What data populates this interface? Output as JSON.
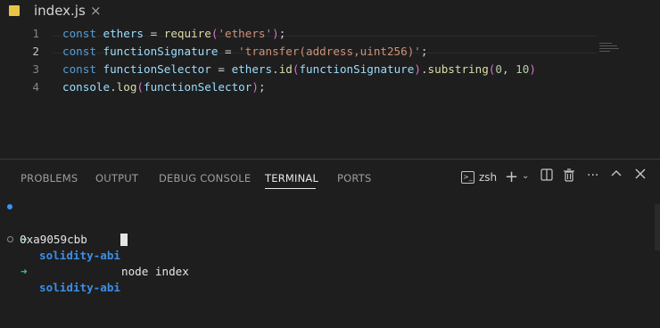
{
  "tab": {
    "name": "index.js",
    "close": "×"
  },
  "editor": {
    "lines": [
      {
        "num": "1",
        "tokens": [
          [
            "kw",
            "const"
          ],
          [
            "pun",
            " "
          ],
          [
            "var",
            "ethers"
          ],
          [
            "pun",
            " = "
          ],
          [
            "fn",
            "require"
          ],
          [
            "br",
            "("
          ],
          [
            "str",
            "'ethers'"
          ],
          [
            "br",
            ")"
          ],
          [
            "pun",
            ";"
          ]
        ]
      },
      {
        "num": "2",
        "tokens": [
          [
            "kw",
            "const"
          ],
          [
            "pun",
            " "
          ],
          [
            "var",
            "functionSignature"
          ],
          [
            "pun",
            " = "
          ],
          [
            "str",
            "'transfer(address,uint256)'"
          ],
          [
            "pun",
            ";"
          ]
        ]
      },
      {
        "num": "3",
        "tokens": [
          [
            "kw",
            "const"
          ],
          [
            "pun",
            " "
          ],
          [
            "var",
            "functionSelector"
          ],
          [
            "pun",
            " = "
          ],
          [
            "var",
            "ethers"
          ],
          [
            "pun",
            "."
          ],
          [
            "fn",
            "id"
          ],
          [
            "br",
            "("
          ],
          [
            "var",
            "functionSignature"
          ],
          [
            "br",
            ")"
          ],
          [
            "pun",
            "."
          ],
          [
            "fn",
            "substring"
          ],
          [
            "br",
            "("
          ],
          [
            "num",
            "0"
          ],
          [
            "pun",
            ", "
          ],
          [
            "num",
            "10"
          ],
          [
            "br",
            ")"
          ]
        ]
      },
      {
        "num": "4",
        "tokens": [
          [
            "var",
            "console"
          ],
          [
            "pun",
            "."
          ],
          [
            "fn",
            "log"
          ],
          [
            "br",
            "("
          ],
          [
            "var",
            "functionSelector"
          ],
          [
            "br",
            ")"
          ],
          [
            "pun",
            ";"
          ]
        ]
      }
    ],
    "active_line": 2
  },
  "panel": {
    "tabs": [
      "PROBLEMS",
      "OUTPUT",
      "DEBUG CONSOLE",
      "TERMINAL",
      "PORTS"
    ],
    "active_tab": "TERMINAL",
    "shell": "zsh",
    "icons": [
      "terminal-icon",
      "plus-icon",
      "chevron-down-icon",
      "split-icon",
      "trash-icon",
      "more-icon",
      "chevron-up-icon",
      "close-icon"
    ]
  },
  "terminal": {
    "arrow": "➜",
    "dir": "solidity-abi",
    "command": "node index",
    "output": "0xa9059cbb",
    "dir2": "solidity-abi"
  }
}
